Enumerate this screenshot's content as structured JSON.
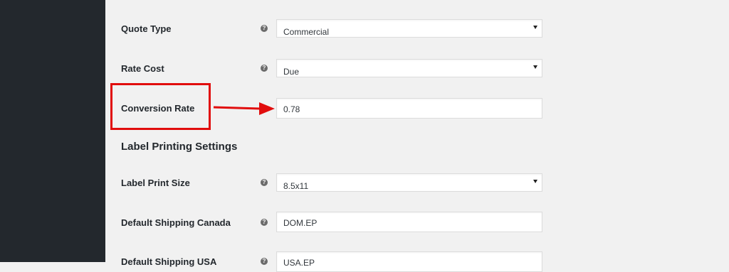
{
  "settings": {
    "quote_type": {
      "label": "Quote Type",
      "help": "?",
      "value": "Commercial"
    },
    "rate_cost": {
      "label": "Rate Cost",
      "help": "?",
      "value": "Due"
    },
    "conversion_rate": {
      "label": "Conversion Rate",
      "value": "0.78"
    },
    "label_section_heading": "Label Printing Settings",
    "label_print_size": {
      "label": "Label Print Size",
      "help": "?",
      "value": "8.5x11"
    },
    "default_shipping_canada": {
      "label": "Default Shipping Canada",
      "help": "?",
      "value": "DOM.EP"
    },
    "default_shipping_usa": {
      "label": "Default Shipping USA",
      "help": "?",
      "value": "USA.EP"
    }
  },
  "annotation": {
    "color": "#e10d0d"
  }
}
